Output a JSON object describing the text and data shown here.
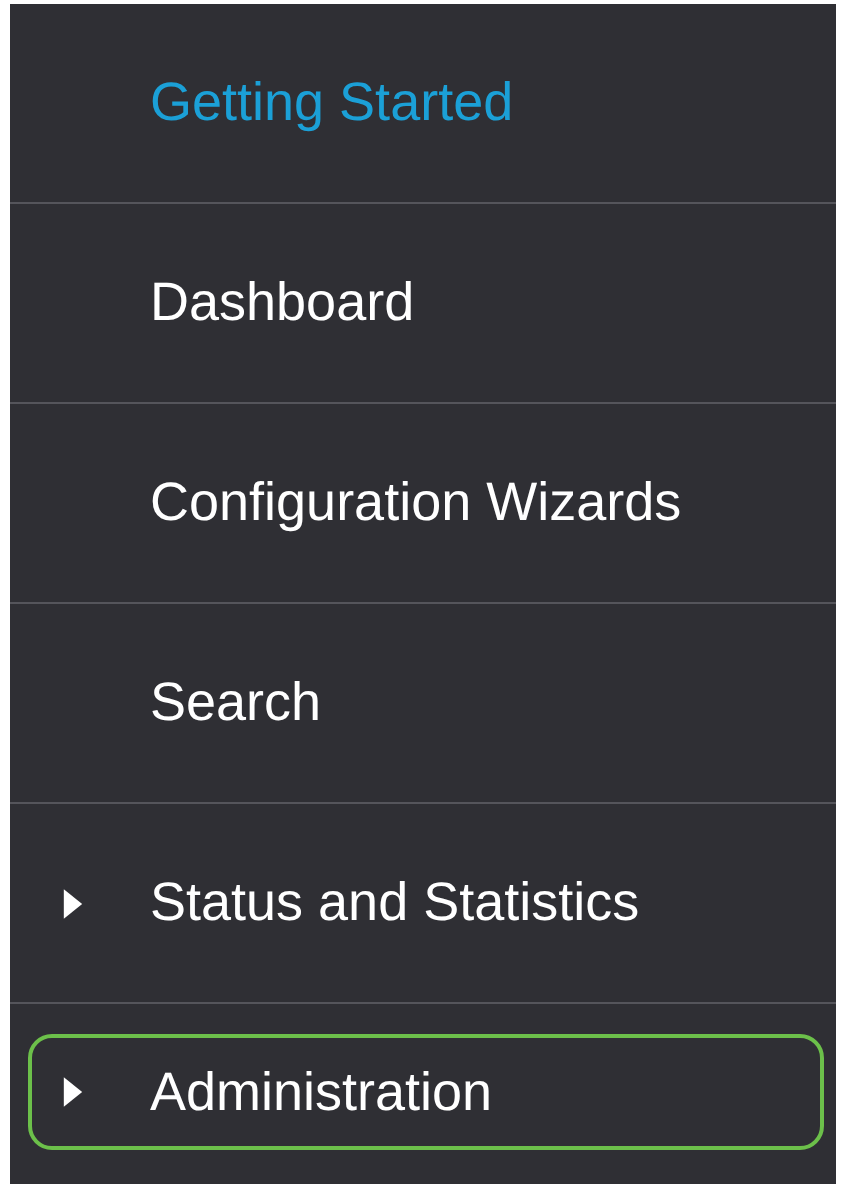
{
  "nav": {
    "items": [
      {
        "label": "Getting Started",
        "kind": "link",
        "selected": true,
        "focused": false
      },
      {
        "label": "Dashboard",
        "kind": "link",
        "selected": false,
        "focused": false
      },
      {
        "label": "Configuration Wizards",
        "kind": "link",
        "selected": false,
        "focused": false
      },
      {
        "label": "Search",
        "kind": "link",
        "selected": false,
        "focused": false
      },
      {
        "label": "Status and Statistics",
        "kind": "group",
        "expanded": false,
        "selected": false,
        "focused": false
      },
      {
        "label": "Administration",
        "kind": "group",
        "expanded": false,
        "selected": false,
        "focused": true
      }
    ]
  }
}
